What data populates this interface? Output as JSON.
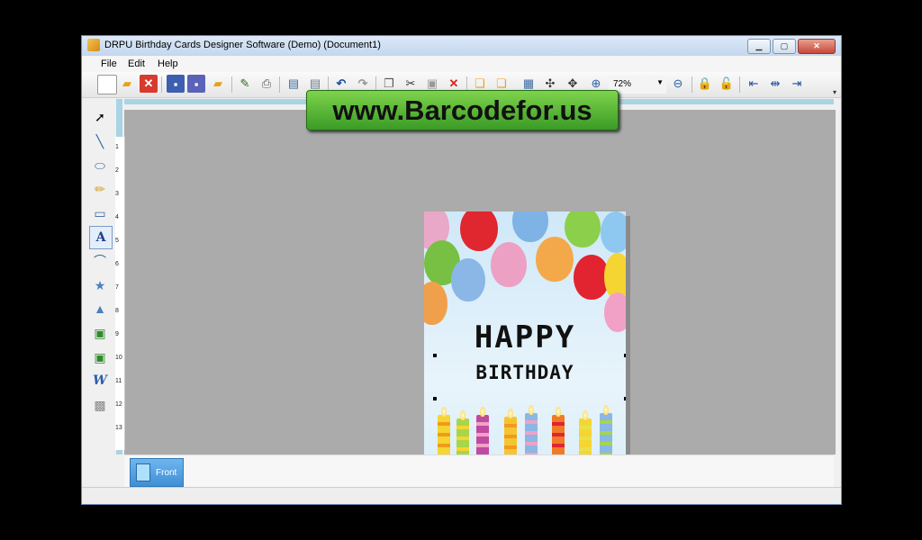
{
  "window": {
    "title": "DRPU Birthday Cards Designer Software (Demo) (Document1)",
    "min_label": "▁",
    "max_label": "▢",
    "close_label": "✕"
  },
  "menu": {
    "file": "File",
    "edit": "Edit",
    "help": "Help"
  },
  "toolbar": {
    "zoom_value": "72%",
    "icons": [
      "new-icon",
      "open-icon",
      "close-document-icon",
      "save-icon",
      "save-as-icon",
      "export-icon",
      "properties-icon",
      "print-icon",
      "database-icon",
      "database-settings-icon",
      "undo-icon",
      "redo-icon",
      "copy-icon",
      "cut-icon",
      "paste-icon",
      "delete-icon",
      "bring-forward-icon",
      "send-backward-icon",
      "grid-icon",
      "center-icon",
      "rotate-icon",
      "zoom-in-icon",
      "zoom-out-icon",
      "lock-icon",
      "unlock-icon",
      "align-left-icon",
      "align-center-icon",
      "align-right-icon"
    ]
  },
  "left_tools": [
    "select-icon",
    "line-icon",
    "ellipse-icon",
    "pencil-icon",
    "rectangle-icon",
    "text-icon",
    "curve-icon",
    "star-icon",
    "triangle-icon",
    "image-icon",
    "image-library-icon",
    "word-art-icon",
    "pattern-icon"
  ],
  "ruler": {
    "marks": [
      "1",
      "2",
      "3",
      "4",
      "5",
      "6",
      "7",
      "8",
      "9",
      "10",
      "11",
      "12",
      "13"
    ]
  },
  "watermark": {
    "text": "www.Barcodefor.us"
  },
  "card": {
    "line1": "HAPPY",
    "line2": "BIRTHDAY"
  },
  "pages": {
    "front": "Front"
  },
  "colors": {
    "accent": "#3e8fd6",
    "banner": "#4caf34",
    "canvas": "#ababab"
  }
}
